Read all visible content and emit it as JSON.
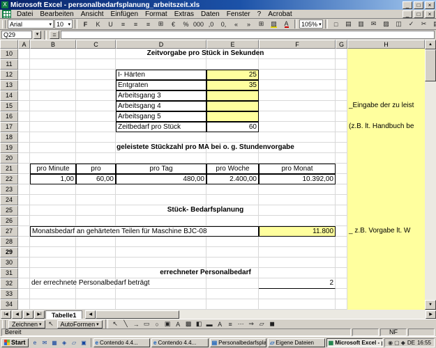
{
  "window": {
    "title": "Microsoft Excel - personalbedarfsplanung_arbeitszeit.xls",
    "app_icon": "X",
    "controls": {
      "minimize": "_",
      "maximize": "□",
      "close": "×"
    }
  },
  "menu": {
    "items": [
      "Datei",
      "Bearbeiten",
      "Ansicht",
      "Einfügen",
      "Format",
      "Extras",
      "Daten",
      "Fenster",
      "?",
      "Acrobat"
    ]
  },
  "toolbar": {
    "font_name": "Arial",
    "font_size": "10",
    "zoom": "105%",
    "help": "?",
    "format_icons": [
      {
        "n": "bold-icon",
        "g": "F",
        "bold": true
      },
      {
        "n": "italic-icon",
        "g": "K"
      },
      {
        "n": "underline-icon",
        "g": "U"
      },
      {
        "n": "align-left-icon",
        "g": "≡"
      },
      {
        "n": "align-center-icon",
        "g": "≡"
      },
      {
        "n": "align-right-icon",
        "g": "≡"
      },
      {
        "n": "merge-center-icon",
        "g": "⊞"
      },
      {
        "n": "currency-euro-icon",
        "g": "€"
      },
      {
        "n": "percent-style-icon",
        "g": "%"
      },
      {
        "n": "thousands-style-icon",
        "g": "000"
      },
      {
        "n": "increase-decimal-icon",
        "g": ",0"
      },
      {
        "n": "decrease-decimal-icon",
        "g": "0,"
      },
      {
        "n": "decrease-indent-icon",
        "g": "«"
      },
      {
        "n": "increase-indent-icon",
        "g": "»"
      },
      {
        "n": "borders-icon",
        "g": "⊞"
      },
      {
        "n": "fill-color-icon",
        "g": "▨",
        "u": "yel"
      },
      {
        "n": "font-color-icon",
        "g": "A",
        "u": "red"
      }
    ],
    "standard_icons": [
      {
        "n": "new-icon",
        "g": "□"
      },
      {
        "n": "open-icon",
        "g": "▤"
      },
      {
        "n": "save-icon",
        "g": "▥"
      },
      {
        "n": "email-icon",
        "g": "✉"
      },
      {
        "n": "print-icon",
        "g": "▨"
      },
      {
        "n": "print-preview-icon",
        "g": "◫"
      },
      {
        "n": "spelling-icon",
        "g": "✓"
      },
      {
        "n": "cut-icon",
        "g": "✂"
      },
      {
        "n": "copy-icon",
        "g": "▤"
      },
      {
        "n": "paste-icon",
        "g": "▧"
      },
      {
        "n": "undo-icon",
        "g": "↶"
      },
      {
        "n": "redo-icon",
        "g": "↷"
      },
      {
        "n": "autosum-icon",
        "g": "Σ"
      },
      {
        "n": "sort-ascending-icon",
        "g": "A↓"
      },
      {
        "n": "sort-descending-icon",
        "g": "Z↓"
      },
      {
        "n": "chart-wizard-icon",
        "g": "▙"
      }
    ]
  },
  "formula_bar": {
    "name_box": "Q29",
    "equals": "=",
    "formula": ""
  },
  "grid": {
    "columns": [
      "A",
      "B",
      "C",
      "D",
      "E",
      "F",
      "G",
      "H"
    ],
    "row_start": 10,
    "row_end": 34,
    "active_row_header": "29",
    "cells": [
      {
        "r": 10,
        "c": "C",
        "to": "F",
        "t": "Zeitvorgabe pro Stück in Sekunden",
        "cls": "title"
      },
      {
        "r": 12,
        "c": "D",
        "t": "I- Härten",
        "cls": "bx"
      },
      {
        "r": 12,
        "c": "E",
        "t": "25",
        "cls": "bx yellow num"
      },
      {
        "r": 13,
        "c": "D",
        "t": "Entgraten",
        "cls": "bx"
      },
      {
        "r": 13,
        "c": "E",
        "t": "35",
        "cls": "bx yellow num"
      },
      {
        "r": 14,
        "c": "D",
        "t": "Arbeitsgang 3",
        "cls": "bx"
      },
      {
        "r": 14,
        "c": "E",
        "t": "",
        "cls": "bx yellow"
      },
      {
        "r": 15,
        "c": "D",
        "t": "Arbeitsgang 4",
        "cls": "bx"
      },
      {
        "r": 15,
        "c": "E",
        "t": "",
        "cls": "bx yellow"
      },
      {
        "r": 16,
        "c": "D",
        "t": "Arbeitsgang 5",
        "cls": "bx"
      },
      {
        "r": 16,
        "c": "E",
        "t": "",
        "cls": "bx yellow"
      },
      {
        "r": 17,
        "c": "D",
        "t": "Zeitbedarf pro Stück",
        "cls": "bx"
      },
      {
        "r": 17,
        "c": "E",
        "t": "60",
        "cls": "bx num"
      },
      {
        "r": 19,
        "c": "C",
        "to": "F",
        "t": "geleistete Stückzahl pro MA bei o. g. Stundenvorgabe",
        "cls": "title"
      },
      {
        "r": 21,
        "c": "B",
        "t": "pro Minute",
        "cls": "bx ctr"
      },
      {
        "r": 21,
        "c": "C",
        "t": "pro",
        "cls": "bx ctr"
      },
      {
        "r": 21,
        "c": "D",
        "t": "pro Tag",
        "cls": "bx ctr"
      },
      {
        "r": 21,
        "c": "E",
        "t": "pro Woche",
        "cls": "bx ctr"
      },
      {
        "r": 21,
        "c": "F",
        "t": "pro Monat",
        "cls": "bx ctr"
      },
      {
        "r": 22,
        "c": "B",
        "t": "1,00",
        "cls": "bx num"
      },
      {
        "r": 22,
        "c": "C",
        "t": "60,00",
        "cls": "bx num"
      },
      {
        "r": 22,
        "c": "D",
        "t": "480,00",
        "cls": "bx num"
      },
      {
        "r": 22,
        "c": "E",
        "t": "2.400,00",
        "cls": "bx num"
      },
      {
        "r": 22,
        "c": "F",
        "t": "10.392,00",
        "cls": "bx num"
      },
      {
        "r": 25,
        "c": "C",
        "to": "F",
        "t": "Stück- Bedarfsplanung",
        "cls": "title"
      },
      {
        "r": 27,
        "c": "B",
        "to": "E",
        "t": "Monatsbedarf an gehärteten Teilen für Maschine BJC-08",
        "cls": "bx"
      },
      {
        "r": 27,
        "c": "F",
        "t": "11.800",
        "cls": "bx yellow num"
      },
      {
        "r": 31,
        "c": "C",
        "to": "F",
        "t": "errechneter Personalbedarf",
        "cls": "title"
      },
      {
        "r": 32,
        "c": "B",
        "to": "E",
        "t": "der errechnete Personalbedarf beträgt",
        "cls": ""
      },
      {
        "r": 32,
        "c": "F",
        "t": "2",
        "cls": "num bot"
      },
      {
        "r": 15,
        "c": "H",
        "t": "_Eingabe der zu leist",
        "cls": "note"
      },
      {
        "r": 17,
        "c": "H",
        "t": "(z.B. lt. Handbuch be",
        "cls": "note"
      },
      {
        "r": 27,
        "c": "H",
        "t": "_ z.B. Vorgabe lt. W",
        "cls": "note"
      }
    ]
  },
  "sheet_tabs": {
    "nav": [
      "I◀",
      "◀",
      "▶",
      "▶I"
    ],
    "tabs": [
      {
        "label": "Tabelle1",
        "active": true
      }
    ]
  },
  "drawing_bar": {
    "zeichnen_label": "Zeichnen",
    "autoformen_label": "AutoFormen",
    "dropdown_glyph": "▾",
    "icons": [
      {
        "n": "select-arrow-icon",
        "g": "↖"
      },
      {
        "n": "line-icon",
        "g": "╲"
      },
      {
        "n": "arrow-icon",
        "g": "→"
      },
      {
        "n": "rectangle-icon",
        "g": "▭"
      },
      {
        "n": "oval-icon",
        "g": "○"
      },
      {
        "n": "textbox-icon",
        "g": "▣"
      },
      {
        "n": "wordart-icon",
        "g": "A"
      },
      {
        "n": "clipart-icon",
        "g": "▩"
      },
      {
        "n": "fill-color-icon",
        "g": "◧"
      },
      {
        "n": "line-color-icon",
        "g": "▬"
      },
      {
        "n": "font-color-icon",
        "g": "A"
      },
      {
        "n": "line-style-icon",
        "g": "≡"
      },
      {
        "n": "dash-style-icon",
        "g": "⋯"
      },
      {
        "n": "arrow-style-icon",
        "g": "⇒"
      },
      {
        "n": "shadow-icon",
        "g": "▱"
      },
      {
        "n": "threed-icon",
        "g": "◼"
      }
    ]
  },
  "status_bar": {
    "ready": "Bereit",
    "numlock": "NF"
  },
  "taskbar": {
    "start_label": "Start",
    "quick_launch": [
      {
        "n": "ie-icon",
        "g": "e"
      },
      {
        "n": "outlook-icon",
        "g": "✉"
      },
      {
        "n": "show-desktop-icon",
        "g": "▦"
      },
      {
        "n": "media-icon",
        "g": "◈"
      },
      {
        "n": "explorer-icon",
        "g": "▱"
      },
      {
        "n": "mail-icon",
        "g": "▣"
      }
    ],
    "tasks": [
      {
        "label": "Contendo 4.4...",
        "icon": "e",
        "active": false
      },
      {
        "label": "Contendo 4.4...",
        "icon": "e",
        "active": false
      },
      {
        "label": "Personalbedarfsplanung...",
        "icon": "▤",
        "active": false
      },
      {
        "label": "Eigene Dateien",
        "icon": "▱",
        "active": false
      },
      {
        "label": "Microsoft Excel - pers...",
        "icon": "▦",
        "active": true
      }
    ],
    "tray": {
      "icons": [
        {
          "n": "volume-icon",
          "g": "◉"
        },
        {
          "n": "display-icon",
          "g": "▢"
        },
        {
          "n": "scheduler-icon",
          "g": "◆"
        }
      ],
      "lang": "DE",
      "clock": "16:55"
    }
  }
}
